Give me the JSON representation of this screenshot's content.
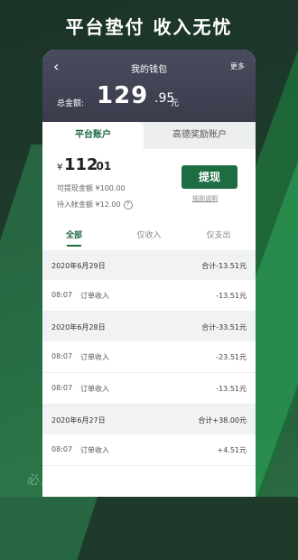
{
  "headline": "平台垫付 收入无忧",
  "nav": {
    "back_glyph": "‹",
    "title": "我的钱包",
    "more": "更多"
  },
  "total": {
    "label": "总金额:",
    "int": "129",
    "dec": ".95",
    "unit": "元"
  },
  "tabs": {
    "platform": "平台账户",
    "reward": "高德奖励账户"
  },
  "balance": {
    "yen": "¥",
    "int": "112",
    "dec": ".01",
    "withdrawable": "可提现金额 ¥100.00",
    "pending": "待入帐金额 ¥12.00",
    "info_glyph": "?"
  },
  "withdraw_button": "提现",
  "rules_link": "规则说明",
  "filters": {
    "all": "全部",
    "income": "仅收入",
    "expense": "仅支出"
  },
  "records": [
    {
      "date": "2020年6月29日",
      "total": "合计-13.51元",
      "items": [
        {
          "time": "08:07",
          "type": "订单收入",
          "amount": "-13.51元"
        }
      ]
    },
    {
      "date": "2020年6月28日",
      "total": "合计-33.51元",
      "items": [
        {
          "time": "08:07",
          "type": "订单收入",
          "amount": "-23.51元"
        },
        {
          "time": "08:07",
          "type": "订单收入",
          "amount": "-13.51元"
        }
      ]
    },
    {
      "date": "2020年6月27日",
      "total": "合计+38.00元",
      "items": [
        {
          "time": "08:07",
          "type": "订单收入",
          "amount": "+4.51元"
        }
      ]
    }
  ],
  "watermark": "必用手机精选 · BYJSJXY.COM",
  "colors": {
    "accent": "#1e6c42",
    "header": "#43455a",
    "bg": "#1d3a2b"
  }
}
